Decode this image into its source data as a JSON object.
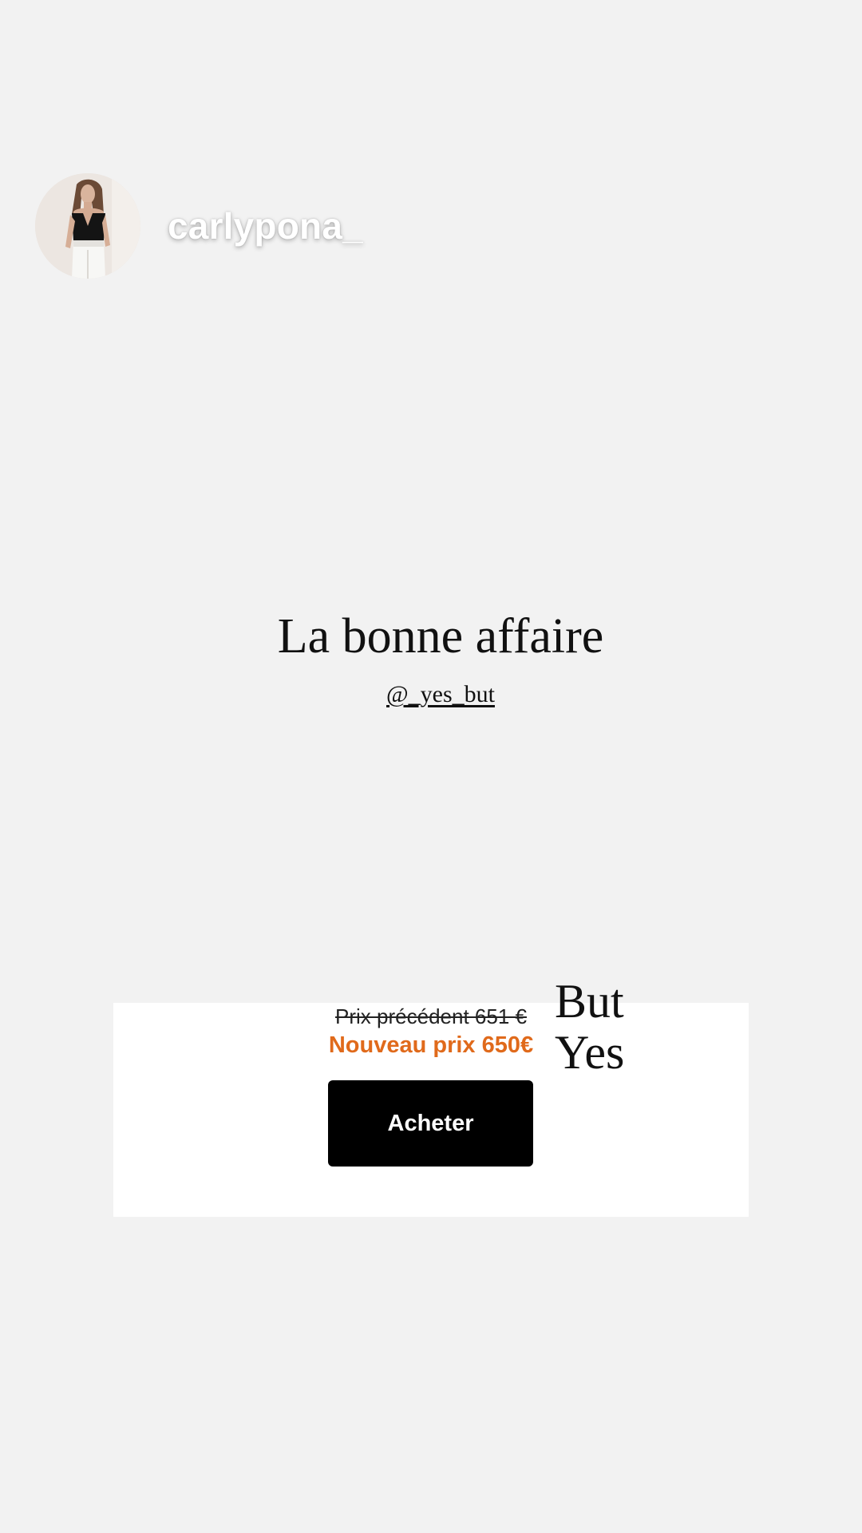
{
  "profile": {
    "username": "carlypona_",
    "avatar_icon": "profile-photo"
  },
  "post": {
    "title": "La bonne affaire",
    "handle": "@_yes_but"
  },
  "offer": {
    "old_price": "Prix précédent 651 €",
    "new_price": "Nouveau prix 650€",
    "buy_label": "Acheter",
    "brand_line_1": "But",
    "brand_line_2": "Yes"
  },
  "colors": {
    "background": "#f2f2f2",
    "panel": "#ffffff",
    "new_price": "#e06a1b",
    "button": "#000000"
  }
}
